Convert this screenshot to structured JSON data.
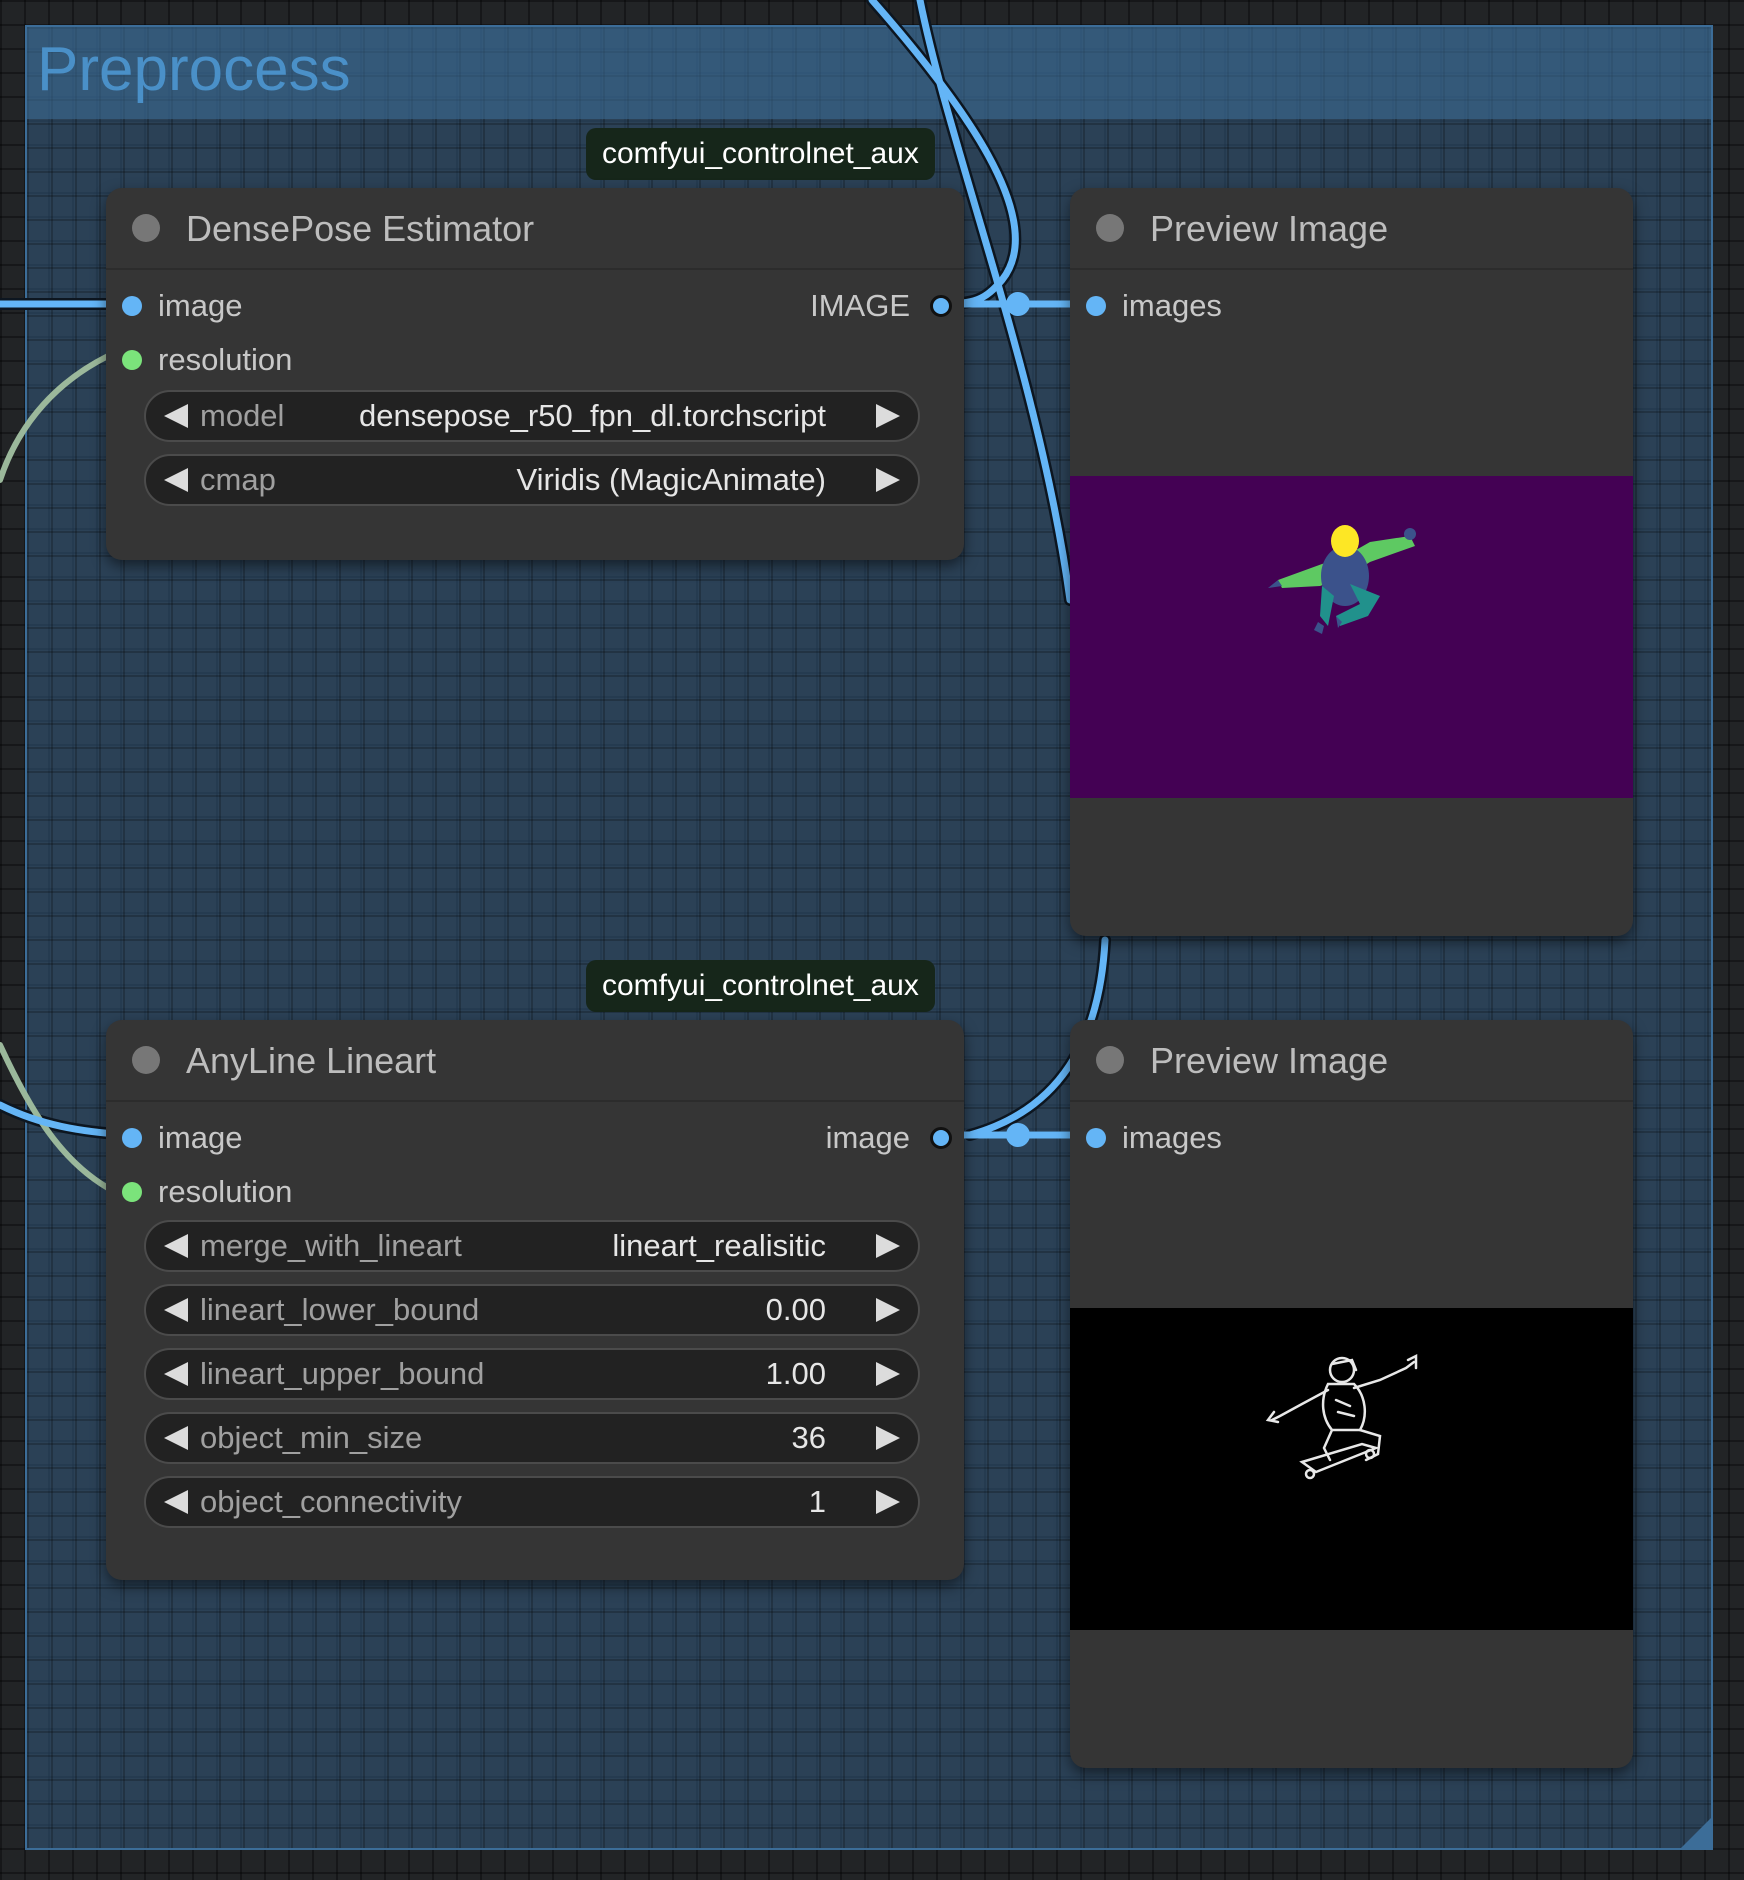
{
  "group": {
    "title": "Preprocess"
  },
  "badges": {
    "top": "comfyui_controlnet_aux",
    "bottom": "comfyui_controlnet_aux"
  },
  "densepose": {
    "title": "DensePose Estimator",
    "inputs": [
      "image",
      "resolution"
    ],
    "output": "IMAGE",
    "widgets": [
      {
        "label": "model",
        "value": "densepose_r50_fpn_dl.torchscript"
      },
      {
        "label": "cmap",
        "value": "Viridis (MagicAnimate)"
      }
    ]
  },
  "anyline": {
    "title": "AnyLine Lineart",
    "inputs": [
      "image",
      "resolution"
    ],
    "output": "image",
    "widgets": [
      {
        "label": "merge_with_lineart",
        "value": "lineart_realisitic"
      },
      {
        "label": "lineart_lower_bound",
        "value": "0.00"
      },
      {
        "label": "lineart_upper_bound",
        "value": "1.00"
      },
      {
        "label": "object_min_size",
        "value": "36"
      },
      {
        "label": "object_connectivity",
        "value": "1"
      }
    ]
  },
  "preview1": {
    "title": "Preview Image",
    "input": "images"
  },
  "preview2": {
    "title": "Preview Image",
    "input": "images"
  },
  "colors": {
    "image_wire": "#64b5f6",
    "resolution_wire": "#9bb89b",
    "densepose_bg": "#440154",
    "lineart_bg": "#000000"
  }
}
